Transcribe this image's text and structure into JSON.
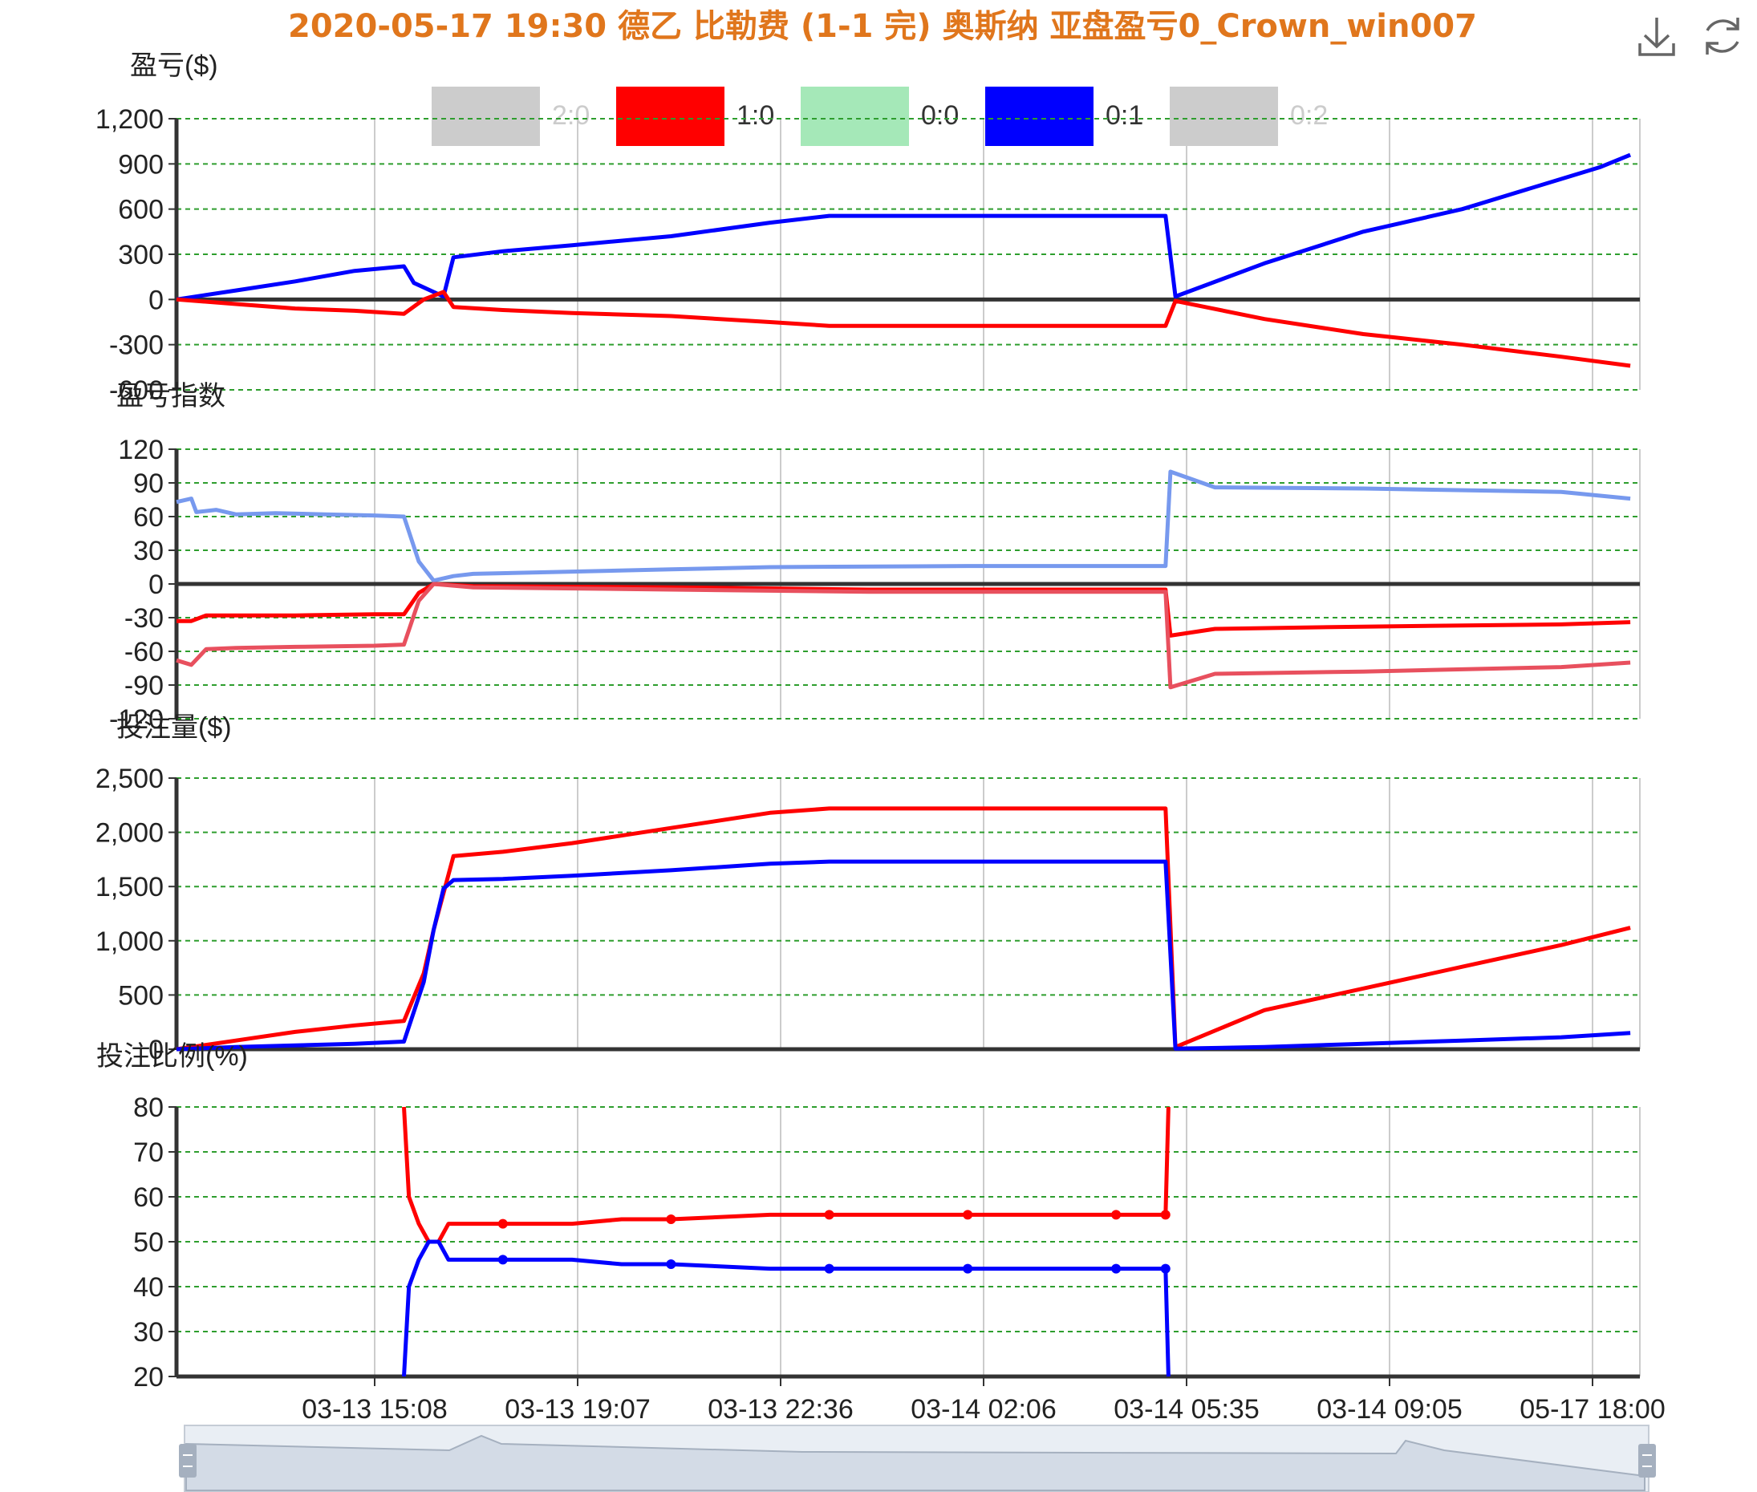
{
  "title": "2020-05-17 19:30 德乙 比勒费 (1-1 完) 奥斯纳 亚盘盈亏0_Crown_win007",
  "colors": {
    "title": "#E0761C",
    "grid": "#2E9E2E",
    "axis": "#333333",
    "series_10": "#FF0000",
    "series_01": "#0000FF",
    "series_10_light": "#E8505E",
    "series_01_light": "#7799EE",
    "legend_off": "#CCCCCC",
    "legend_00": "#A5E8B8",
    "slider_fill": "#D3DBE6",
    "slider_line": "#A5B0BF"
  },
  "legend": [
    {
      "label": "2:0",
      "color": "#CCCCCC",
      "active": false
    },
    {
      "label": "1:0",
      "color": "#FF0000",
      "active": true
    },
    {
      "label": "0:0",
      "color": "#A5E8B8",
      "active": true
    },
    {
      "label": "0:1",
      "color": "#0000FF",
      "active": true
    },
    {
      "label": "0:2",
      "color": "#CCCCCC",
      "active": false
    }
  ],
  "toolbox": [
    {
      "name": "download-icon",
      "label": "save"
    },
    {
      "name": "refresh-icon",
      "label": "restore"
    }
  ],
  "x_ticks": [
    "03-13 15:08",
    "03-13 19:07",
    "03-13 22:36",
    "03-14 02:06",
    "03-14 05:35",
    "03-14 09:05",
    "05-17 18:00"
  ],
  "chart_data": [
    {
      "type": "line",
      "title": "盈亏($)",
      "ylim": [
        -600,
        1200
      ],
      "yticks": [
        "1,200",
        "900",
        "600",
        "300",
        "0",
        "-300",
        "-600"
      ],
      "ytick_values": [
        1200,
        900,
        600,
        300,
        0,
        -300,
        -600
      ],
      "series": [
        {
          "name": "0:1",
          "color": "#0000FF",
          "points": [
            [
              0,
              0
            ],
            [
              0.06,
              60
            ],
            [
              0.12,
              120
            ],
            [
              0.18,
              190
            ],
            [
              0.23,
              220
            ],
            [
              0.24,
              110
            ],
            [
              0.27,
              20
            ],
            [
              0.28,
              280
            ],
            [
              0.33,
              320
            ],
            [
              0.4,
              360
            ],
            [
              0.5,
              420
            ],
            [
              0.6,
              510
            ],
            [
              0.66,
              555
            ],
            [
              0.75,
              555
            ],
            [
              0.85,
              555
            ],
            [
              0.95,
              555
            ],
            [
              1.0,
              555
            ],
            [
              1.01,
              20
            ],
            [
              1.1,
              240
            ],
            [
              1.2,
              450
            ],
            [
              1.3,
              600
            ],
            [
              1.4,
              800
            ],
            [
              1.44,
              880
            ],
            [
              1.47,
              960
            ]
          ]
        },
        {
          "name": "1:0",
          "color": "#FF0000",
          "points": [
            [
              0,
              0
            ],
            [
              0.06,
              -30
            ],
            [
              0.12,
              -60
            ],
            [
              0.18,
              -75
            ],
            [
              0.23,
              -95
            ],
            [
              0.25,
              0
            ],
            [
              0.27,
              50
            ],
            [
              0.28,
              -50
            ],
            [
              0.33,
              -70
            ],
            [
              0.4,
              -90
            ],
            [
              0.5,
              -110
            ],
            [
              0.6,
              -150
            ],
            [
              0.66,
              -175
            ],
            [
              0.75,
              -175
            ],
            [
              0.85,
              -175
            ],
            [
              0.95,
              -175
            ],
            [
              1.0,
              -175
            ],
            [
              1.01,
              -10
            ],
            [
              1.1,
              -130
            ],
            [
              1.2,
              -230
            ],
            [
              1.3,
              -300
            ],
            [
              1.4,
              -380
            ],
            [
              1.47,
              -440
            ]
          ]
        }
      ]
    },
    {
      "type": "line",
      "title": "盈亏指数",
      "ylim": [
        -120,
        120
      ],
      "yticks": [
        "120",
        "90",
        "60",
        "30",
        "0",
        "-30",
        "-60",
        "-90",
        "-120"
      ],
      "ytick_values": [
        120,
        90,
        60,
        30,
        0,
        -30,
        -60,
        -90,
        -120
      ],
      "series": [
        {
          "name": "0:1",
          "color": "#7799EE",
          "points": [
            [
              0,
              73
            ],
            [
              0.015,
              76
            ],
            [
              0.02,
              64
            ],
            [
              0.04,
              66
            ],
            [
              0.06,
              62
            ],
            [
              0.1,
              63
            ],
            [
              0.15,
              62
            ],
            [
              0.2,
              61
            ],
            [
              0.23,
              60
            ],
            [
              0.245,
              20
            ],
            [
              0.26,
              3
            ],
            [
              0.28,
              7
            ],
            [
              0.3,
              9
            ],
            [
              0.4,
              11
            ],
            [
              0.5,
              13
            ],
            [
              0.6,
              15
            ],
            [
              0.8,
              16
            ],
            [
              1.0,
              16
            ],
            [
              1.005,
              100
            ],
            [
              1.05,
              86
            ],
            [
              1.2,
              85
            ],
            [
              1.4,
              82
            ],
            [
              1.47,
              76
            ]
          ]
        },
        {
          "name": "1:0",
          "color": "#FF0000",
          "points": [
            [
              0,
              -33
            ],
            [
              0.015,
              -33
            ],
            [
              0.03,
              -28
            ],
            [
              0.06,
              -28
            ],
            [
              0.12,
              -28
            ],
            [
              0.2,
              -27
            ],
            [
              0.23,
              -27
            ],
            [
              0.245,
              -8
            ],
            [
              0.26,
              0
            ],
            [
              0.3,
              -2
            ],
            [
              0.5,
              -3
            ],
            [
              0.7,
              -5
            ],
            [
              1.0,
              -5
            ],
            [
              1.005,
              -46
            ],
            [
              1.05,
              -40
            ],
            [
              1.2,
              -38
            ],
            [
              1.4,
              -36
            ],
            [
              1.47,
              -34
            ]
          ]
        },
        {
          "name": "1:0",
          "color": "#E8505E",
          "points": [
            [
              0,
              -68
            ],
            [
              0.015,
              -72
            ],
            [
              0.03,
              -58
            ],
            [
              0.06,
              -57
            ],
            [
              0.12,
              -56
            ],
            [
              0.2,
              -55
            ],
            [
              0.23,
              -54
            ],
            [
              0.245,
              -15
            ],
            [
              0.26,
              0
            ],
            [
              0.3,
              -3
            ],
            [
              0.5,
              -5
            ],
            [
              0.7,
              -7
            ],
            [
              1.0,
              -7
            ],
            [
              1.005,
              -92
            ],
            [
              1.05,
              -80
            ],
            [
              1.2,
              -78
            ],
            [
              1.4,
              -74
            ],
            [
              1.47,
              -70
            ]
          ]
        }
      ]
    },
    {
      "type": "line",
      "title": "投注量($)",
      "ylim": [
        0,
        2500
      ],
      "yticks": [
        "2,500",
        "2,000",
        "1,500",
        "1,000",
        "500",
        "0"
      ],
      "ytick_values": [
        2500,
        2000,
        1500,
        1000,
        500,
        0
      ],
      "series": [
        {
          "name": "1:0",
          "color": "#FF0000",
          "points": [
            [
              0,
              0
            ],
            [
              0.06,
              80
            ],
            [
              0.12,
              160
            ],
            [
              0.18,
              220
            ],
            [
              0.23,
              260
            ],
            [
              0.25,
              700
            ],
            [
              0.26,
              1100
            ],
            [
              0.28,
              1780
            ],
            [
              0.33,
              1820
            ],
            [
              0.4,
              1900
            ],
            [
              0.5,
              2040
            ],
            [
              0.6,
              2180
            ],
            [
              0.66,
              2220
            ],
            [
              0.75,
              2220
            ],
            [
              0.85,
              2220
            ],
            [
              0.95,
              2220
            ],
            [
              1.0,
              2220
            ],
            [
              1.01,
              20
            ],
            [
              1.1,
              360
            ],
            [
              1.2,
              560
            ],
            [
              1.3,
              760
            ],
            [
              1.4,
              960
            ],
            [
              1.47,
              1120
            ]
          ]
        },
        {
          "name": "0:1",
          "color": "#0000FF",
          "points": [
            [
              0,
              0
            ],
            [
              0.06,
              20
            ],
            [
              0.12,
              35
            ],
            [
              0.18,
              50
            ],
            [
              0.23,
              70
            ],
            [
              0.25,
              620
            ],
            [
              0.26,
              1100
            ],
            [
              0.27,
              1480
            ],
            [
              0.28,
              1560
            ],
            [
              0.33,
              1570
            ],
            [
              0.4,
              1600
            ],
            [
              0.5,
              1650
            ],
            [
              0.6,
              1710
            ],
            [
              0.66,
              1730
            ],
            [
              0.75,
              1730
            ],
            [
              0.85,
              1730
            ],
            [
              0.95,
              1730
            ],
            [
              1.0,
              1730
            ],
            [
              1.01,
              5
            ],
            [
              1.1,
              20
            ],
            [
              1.2,
              50
            ],
            [
              1.3,
              80
            ],
            [
              1.4,
              110
            ],
            [
              1.47,
              150
            ]
          ]
        }
      ]
    },
    {
      "type": "line",
      "title": "投注比例(%)",
      "ylim": [
        20,
        80
      ],
      "yticks": [
        "80",
        "70",
        "60",
        "50",
        "40",
        "30",
        "20"
      ],
      "ytick_values": [
        80,
        70,
        60,
        50,
        40,
        30,
        20
      ],
      "series": [
        {
          "name": "1:0",
          "color": "#FF0000",
          "points": [
            [
              0.23,
              80
            ],
            [
              0.235,
              60
            ],
            [
              0.245,
              54
            ],
            [
              0.255,
              50
            ],
            [
              0.265,
              50
            ],
            [
              0.275,
              54
            ],
            [
              0.3,
              54
            ],
            [
              0.4,
              54
            ],
            [
              0.45,
              55
            ],
            [
              0.5,
              55
            ],
            [
              0.6,
              56
            ],
            [
              0.66,
              56
            ],
            [
              0.8,
              56
            ],
            [
              1.0,
              56
            ],
            [
              1.003,
              80
            ]
          ],
          "markers": [
            [
              0.33,
              54
            ],
            [
              0.5,
              55
            ],
            [
              0.66,
              56
            ],
            [
              0.8,
              56
            ],
            [
              0.95,
              56
            ],
            [
              1.0,
              56
            ]
          ]
        },
        {
          "name": "0:1",
          "color": "#0000FF",
          "points": [
            [
              0.23,
              20
            ],
            [
              0.235,
              40
            ],
            [
              0.245,
              46
            ],
            [
              0.255,
              50
            ],
            [
              0.265,
              50
            ],
            [
              0.275,
              46
            ],
            [
              0.3,
              46
            ],
            [
              0.4,
              46
            ],
            [
              0.45,
              45
            ],
            [
              0.5,
              45
            ],
            [
              0.6,
              44
            ],
            [
              0.66,
              44
            ],
            [
              0.8,
              44
            ],
            [
              1.0,
              44
            ],
            [
              1.003,
              20
            ]
          ],
          "markers": [
            [
              0.33,
              46
            ],
            [
              0.5,
              45
            ],
            [
              0.66,
              44
            ],
            [
              0.8,
              44
            ],
            [
              0.95,
              44
            ],
            [
              1.0,
              44
            ]
          ]
        }
      ]
    }
  ]
}
